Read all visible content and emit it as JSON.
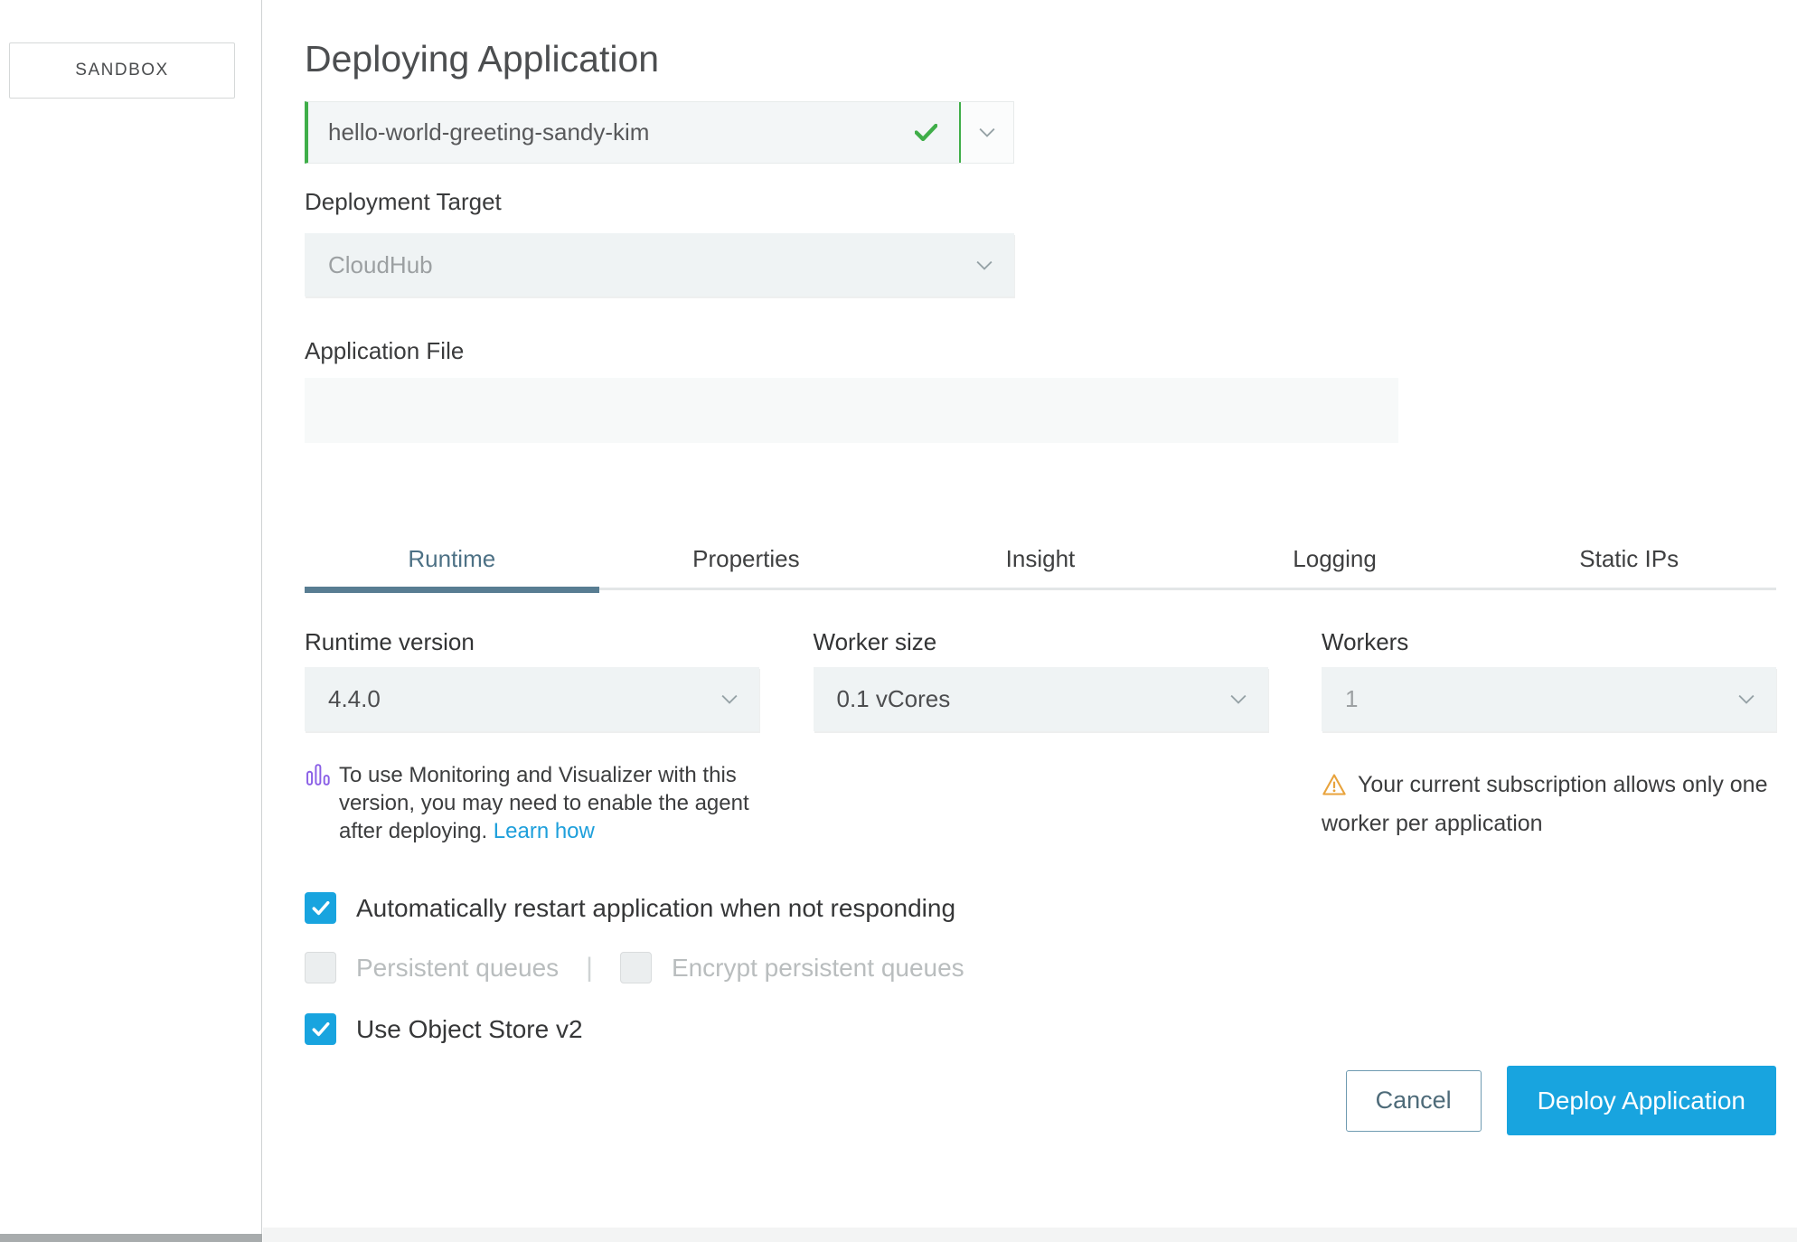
{
  "sidebar": {
    "environment_label": "SANDBOX"
  },
  "header": {
    "title": "Deploying Application"
  },
  "form": {
    "app_name": {
      "value": "hello-world-greeting-sandy-kim",
      "valid": true
    },
    "deployment_target": {
      "label": "Deployment Target",
      "value": "CloudHub"
    },
    "application_file": {
      "label": "Application File",
      "value": ""
    }
  },
  "tabs": [
    {
      "label": "Runtime",
      "active": true
    },
    {
      "label": "Properties",
      "active": false
    },
    {
      "label": "Insight",
      "active": false
    },
    {
      "label": "Logging",
      "active": false
    },
    {
      "label": "Static IPs",
      "active": false
    }
  ],
  "runtime": {
    "runtime_version": {
      "label": "Runtime version",
      "value": "4.4.0"
    },
    "worker_size": {
      "label": "Worker size",
      "value": "0.1 vCores"
    },
    "workers": {
      "label": "Workers",
      "value": "1",
      "disabled": true
    },
    "monitoring_note": {
      "text": "To use Monitoring and Visualizer with this version, you may need to enable the agent after deploying.",
      "link_label": "Learn how"
    },
    "workers_warning": {
      "text": "Your current subscription allows only one worker per application"
    },
    "options": [
      {
        "label": "Automatically restart application when not responding",
        "checked": true,
        "disabled": false
      },
      {
        "label": "Persistent queues",
        "checked": false,
        "disabled": true
      },
      {
        "label": "Encrypt persistent queues",
        "checked": false,
        "disabled": true
      },
      {
        "label": "Use Object Store v2",
        "checked": true,
        "disabled": false
      }
    ],
    "divider": "|"
  },
  "actions": {
    "cancel_label": "Cancel",
    "deploy_label": "Deploy Application"
  },
  "icons": {
    "success_check": "check-icon",
    "chevron_down": "chevron-down-icon",
    "monitoring": "equalizer-bars-icon",
    "warning": "warning-triangle-icon",
    "checkbox_check": "check-icon"
  },
  "colors": {
    "accent_blue": "#18a4df",
    "success_green": "#3fae49",
    "warning_orange": "#e8a33c",
    "monitoring_purple": "#8a5fe6",
    "tab_active_slate": "#587d92",
    "link_blue": "#1d9fdb"
  }
}
